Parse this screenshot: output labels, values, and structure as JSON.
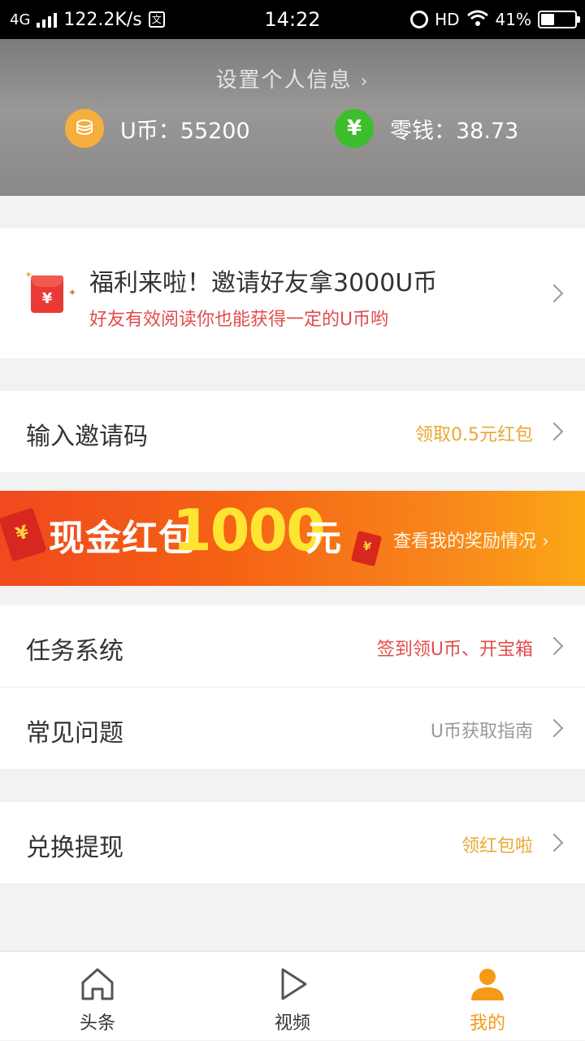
{
  "status_bar": {
    "network": "4G",
    "speed": "122.2K/s",
    "time": "14:22",
    "hd": "HD",
    "battery": "41%"
  },
  "header": {
    "set_info_label": "设置个人信息",
    "coins_label": "U币：55200",
    "change_label": "零钱：38.73",
    "change_icon": "¥"
  },
  "promo": {
    "title": "福利来啦！邀请好友拿3000U币",
    "subtitle": "好友有效阅读你也能获得一定的U币哟",
    "env_symbol": "¥"
  },
  "invite_code": {
    "label": "输入邀请码",
    "hint": "领取0.5元红包",
    "hint_color": "#e8a935"
  },
  "banner": {
    "text": "现金红包",
    "amount": "1000",
    "unit": "元",
    "link": "查看我的奖励情况",
    "symbol": "¥"
  },
  "menu": {
    "tasks_label": "任务系统",
    "tasks_hint": "签到领U币、开宝箱",
    "faq_label": "常见问题",
    "faq_hint": "U币获取指南",
    "withdraw_label": "兑换提现",
    "withdraw_hint": "领红包啦"
  },
  "tabs": {
    "headlines": "头条",
    "video": "视频",
    "mine": "我的",
    "active_color": "#f49a16"
  }
}
